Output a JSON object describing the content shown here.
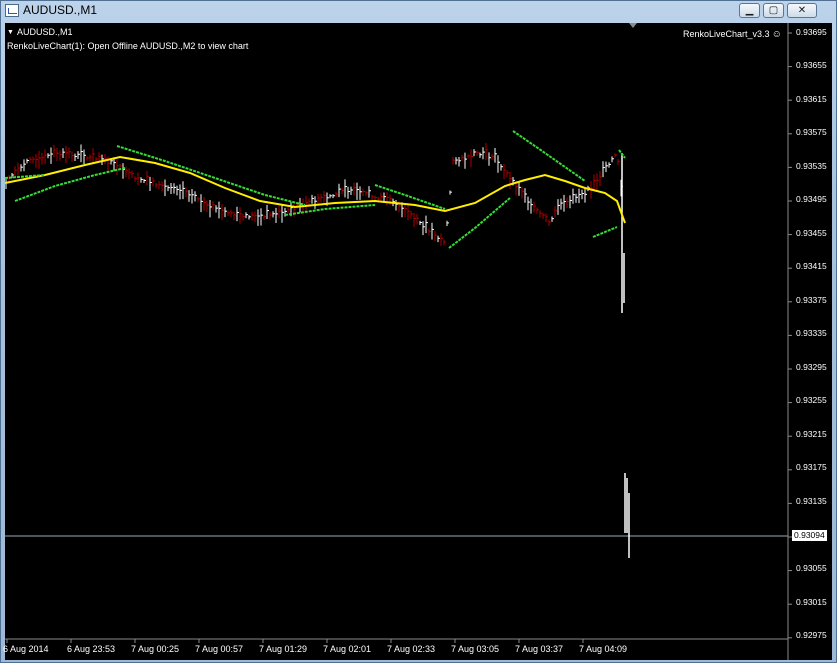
{
  "window": {
    "title": "AUDUSD.,M1",
    "buttons": {
      "minimize": "▁",
      "maximize": "▢",
      "close": "✕"
    }
  },
  "chart": {
    "symbol_label": "AUDUSD.,M1",
    "note": "RenkoLiveChart(1): Open Offline AUDUSD.,M2 to view chart",
    "indicator_label": "RenkoLiveChart_v3.3",
    "current_price": "0.93094",
    "price_labels": [
      "0.93695",
      "0.93655",
      "0.93615",
      "0.93575",
      "0.93535",
      "0.93495",
      "0.93455",
      "0.93415",
      "0.93375",
      "0.93335",
      "0.93295",
      "0.93255",
      "0.93215",
      "0.93175",
      "0.93135",
      "0.93055",
      "0.93015",
      "0.92975"
    ],
    "time_labels": [
      "6 Aug 2014",
      "6 Aug 23:53",
      "7 Aug 00:25",
      "7 Aug 00:57",
      "7 Aug 01:29",
      "7 Aug 02:01",
      "7 Aug 02:33",
      "7 Aug 03:05",
      "7 Aug 03:37",
      "7 Aug 04:09"
    ],
    "colors": {
      "background": "#000000",
      "bars": "#ffffff",
      "down_bars": "#b00000",
      "moving_average": "#ffee00",
      "band": "#33dd33"
    }
  }
}
